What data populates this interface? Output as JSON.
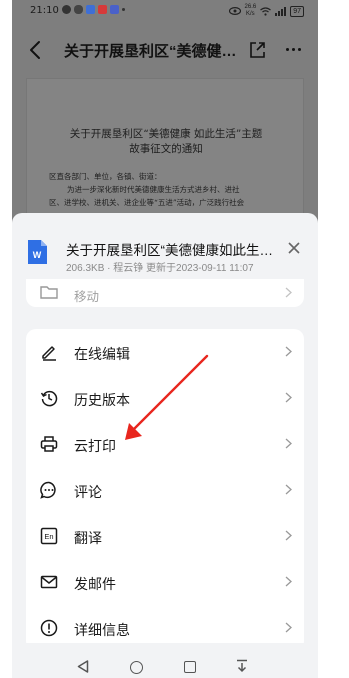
{
  "status": {
    "time": "21:10",
    "network_speed_value": "26.6",
    "network_speed_unit": "K/s",
    "battery": "97"
  },
  "header": {
    "title": "关于开展垦利区“美德健…"
  },
  "document": {
    "heading_line1": "关于开展垦利区“美德健康 如此生活”主题",
    "heading_line2": "故事征文的通知",
    "recipients": "区直各部门、单位，各镇、街道：",
    "body_line1": "为进一步深化新时代美德健康生活方式进乡村、进社",
    "body_line2": "区、进学校、进机关、进企业等“五进”活动，广泛践行社会"
  },
  "sheet": {
    "file_name": "关于开展垦利区“美德健康如此生…",
    "file_meta": "206.3KB · 程云铮 更新于2023-09-11 11:07",
    "partial_item": "移动",
    "items": [
      {
        "label": "在线编辑"
      },
      {
        "label": "历史版本"
      },
      {
        "label": "云打印"
      },
      {
        "label": "评论"
      },
      {
        "label": "翻译"
      },
      {
        "label": "发邮件"
      },
      {
        "label": "详细信息"
      }
    ]
  },
  "colors": {
    "accent_wps": "#2f6fe4",
    "annotation_arrow": "#e8261e"
  }
}
